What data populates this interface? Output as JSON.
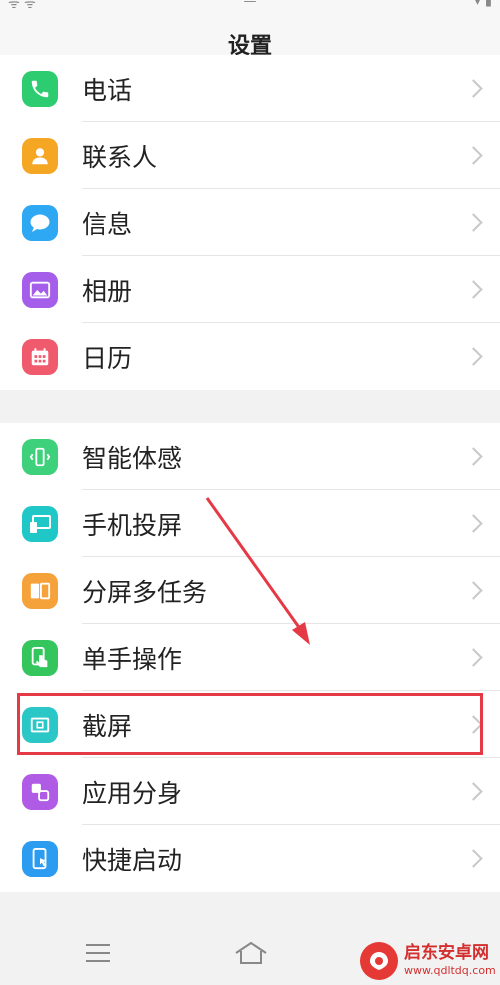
{
  "status_bar": {
    "left": "ᯤ ᯤ",
    "center": "—",
    "right": "▾ ▮"
  },
  "header": {
    "title": "设置"
  },
  "group1": [
    {
      "label": "电话",
      "icon": "phone-icon",
      "color": "#2ecc71"
    },
    {
      "label": "联系人",
      "icon": "contact-icon",
      "color": "#f5a623"
    },
    {
      "label": "信息",
      "icon": "message-icon",
      "color": "#2fa8f3"
    },
    {
      "label": "相册",
      "icon": "album-icon",
      "color": "#a55eea"
    },
    {
      "label": "日历",
      "icon": "calendar-icon",
      "color": "#ef5b6c"
    }
  ],
  "group2": [
    {
      "label": "智能体感",
      "icon": "motion-sense-icon",
      "color": "#3ed07a"
    },
    {
      "label": "手机投屏",
      "icon": "screen-cast-icon",
      "color": "#1fc7c7"
    },
    {
      "label": "分屏多任务",
      "icon": "split-screen-icon",
      "color": "#f6a23a"
    },
    {
      "label": "单手操作",
      "icon": "one-hand-icon",
      "color": "#34c65d"
    },
    {
      "label": "截屏",
      "icon": "screenshot-icon",
      "color": "#2bc6c6"
    },
    {
      "label": "应用分身",
      "icon": "app-clone-icon",
      "color": "#b05be6"
    },
    {
      "label": "快捷启动",
      "icon": "quick-launch-icon",
      "color": "#2b9cf0"
    }
  ],
  "nav": {
    "menu_icon": "menu-icon",
    "home_icon": "home-icon"
  },
  "watermark": {
    "name": "启东安卓网",
    "url": "www.qdltdq.com"
  },
  "annotation": {
    "highlight_color": "#e63946",
    "arrow_color": "#e63946"
  }
}
